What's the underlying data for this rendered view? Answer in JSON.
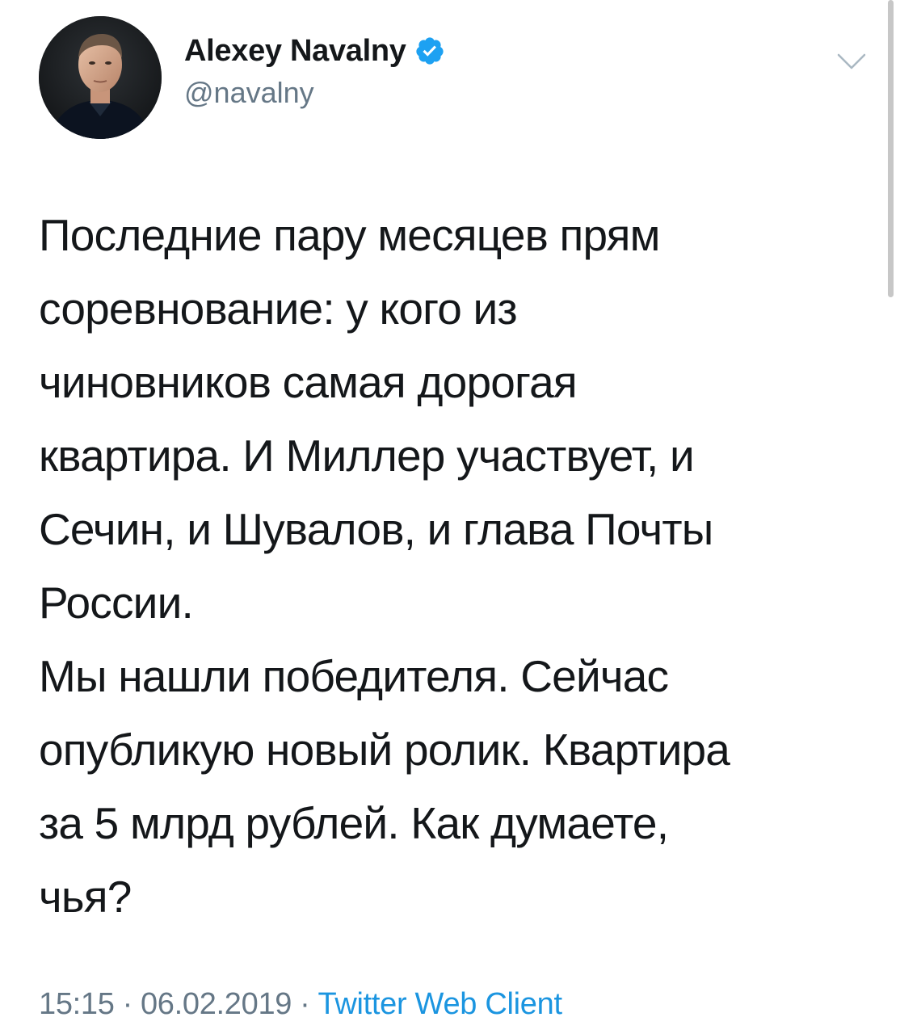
{
  "author": {
    "display_name": "Alexey Navalny",
    "handle": "@navalny",
    "verified": true,
    "avatar_icon": "profile-photo"
  },
  "tweet": {
    "lines": [
      "Последние пару месяцев прям",
      "соревнование: у кого из",
      "чиновников самая дорогая",
      "квартира. И Миллер участвует, и",
      "Сечин, и Шувалов, и глава Почты",
      "России.",
      "Мы нашли победителя. Сейчас",
      "опубликую новый ролик. Квартира",
      "за 5 млрд рублей. Как думаете,",
      "чья?"
    ]
  },
  "meta": {
    "time": "15:15",
    "separator": "·",
    "date": "06.02.2019",
    "source": "Twitter Web Client"
  },
  "icons": {
    "verified": "verified-badge-icon",
    "menu": "chevron-down-icon"
  },
  "colors": {
    "text": "#14171a",
    "secondary": "#657786",
    "link": "#1b95e0",
    "verified": "#1da1f2"
  }
}
